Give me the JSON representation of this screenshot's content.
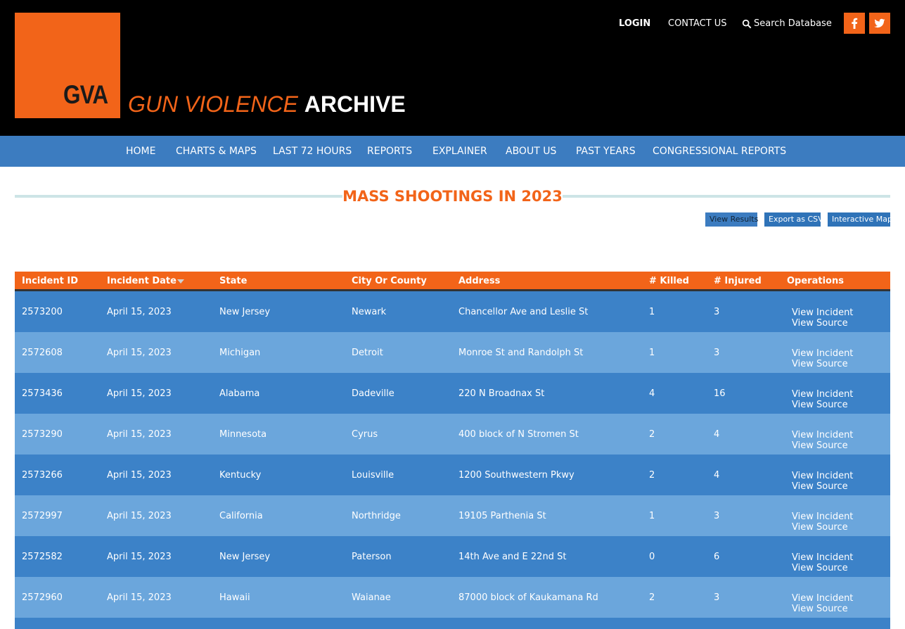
{
  "header": {
    "logo_text": "GVA",
    "title_part1": "GUN VIOLENCE",
    "title_part2": "ARCHIVE",
    "login": "LOGIN",
    "contact": "CONTACT US",
    "search": "Search Database",
    "brand_color": "#f26419"
  },
  "nav": [
    "HOME",
    "CHARTS & MAPS",
    "LAST 72 HOURS",
    "REPORTS",
    "EXPLAINER",
    "ABOUT US",
    "PAST YEARS",
    "CONGRESSIONAL REPORTS"
  ],
  "page": {
    "title": "MASS SHOOTINGS IN 2023",
    "buttons": {
      "view_results": "View Results",
      "export_csv": "Export as CSV",
      "interactive_map": "Interactive Map"
    }
  },
  "table": {
    "headers": {
      "id": "Incident ID",
      "date": "Incident Date",
      "state": "State",
      "city": "City Or County",
      "address": "Address",
      "killed": "# Killed",
      "injured": "# Injured",
      "operations": "Operations"
    },
    "op_labels": {
      "incident": "View Incident",
      "source": "View Source"
    },
    "rows": [
      {
        "id": "2573200",
        "date": "April 15, 2023",
        "state": "New Jersey",
        "city": "Newark",
        "address": "Chancellor Ave and Leslie St",
        "killed": "1",
        "injured": "3"
      },
      {
        "id": "2572608",
        "date": "April 15, 2023",
        "state": "Michigan",
        "city": "Detroit",
        "address": "Monroe St and Randolph St",
        "killed": "1",
        "injured": "3"
      },
      {
        "id": "2573436",
        "date": "April 15, 2023",
        "state": "Alabama",
        "city": "Dadeville",
        "address": "220 N Broadnax St",
        "killed": "4",
        "injured": "16"
      },
      {
        "id": "2573290",
        "date": "April 15, 2023",
        "state": "Minnesota",
        "city": "Cyrus",
        "address": "400 block of N Stromen St",
        "killed": "2",
        "injured": "4"
      },
      {
        "id": "2573266",
        "date": "April 15, 2023",
        "state": "Kentucky",
        "city": "Louisville",
        "address": "1200 Southwestern Pkwy",
        "killed": "2",
        "injured": "4"
      },
      {
        "id": "2572997",
        "date": "April 15, 2023",
        "state": "California",
        "city": "Northridge",
        "address": "19105 Parthenia St",
        "killed": "1",
        "injured": "3"
      },
      {
        "id": "2572582",
        "date": "April 15, 2023",
        "state": "New Jersey",
        "city": "Paterson",
        "address": "14th Ave and E 22nd St",
        "killed": "0",
        "injured": "6"
      },
      {
        "id": "2572960",
        "date": "April 15, 2023",
        "state": "Hawaii",
        "city": "Waianae",
        "address": "87000 block of Kaukamana Rd",
        "killed": "2",
        "injured": "3"
      }
    ]
  }
}
